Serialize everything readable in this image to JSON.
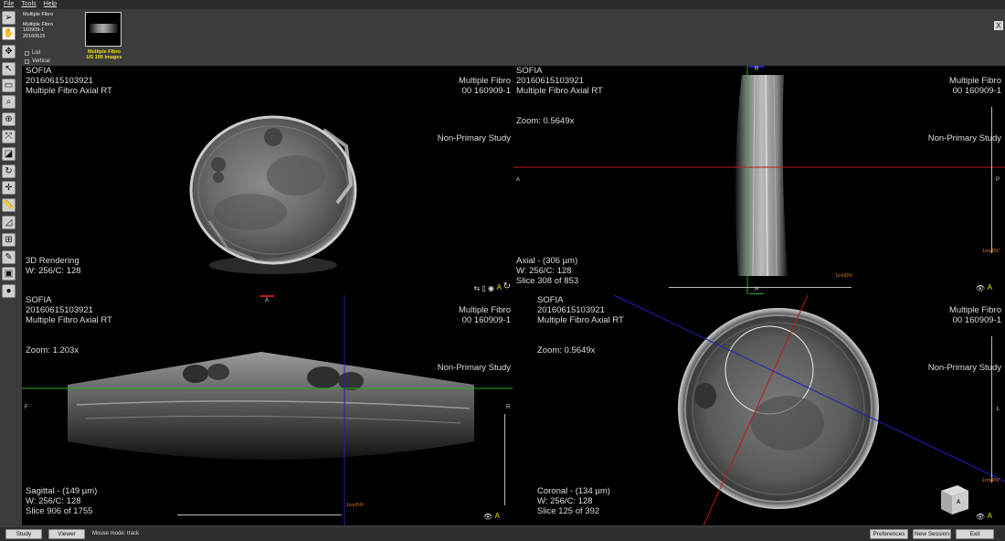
{
  "menu": {
    "file": "File",
    "tools": "Tools",
    "help": "Help"
  },
  "header": {
    "study_name": "Multiple Fibro",
    "patient_name": "Multiple Fibro",
    "patient_id": "160909-1",
    "study_date": "20160615",
    "thumb_label_1": "Multiple Fibro",
    "thumb_label_2": "US 195 images",
    "opt_list": "List",
    "opt_vertical": "Vertical",
    "close": "X"
  },
  "viewports": {
    "tl": {
      "inst": "SOFIA",
      "datetime": "20160615103921",
      "series": "Multiple Fibro Axial RT",
      "patient": "Multiple Fibro",
      "pid": "00   160909-1",
      "nonprimary": "Non-Primary Study",
      "mode": "3D Rendering",
      "wc": "W: 256/C: 128",
      "icons": "⇆ ▯ ◉",
      "orient": "A"
    },
    "tr": {
      "inst": "SOFIA",
      "datetime": "20160615103921",
      "series": "Multiple Fibro Axial RT",
      "patient": "Multiple Fibro",
      "pid": "00   160909-1",
      "zoom": "Zoom: 0.5649x",
      "nonprimary": "Non-Primary Study",
      "mode": "Axial - (306 µm)",
      "wc": "W: 256/C: 128",
      "slice": "Slice 308 of 853",
      "scale": "1cm/DIV",
      "orient": "A",
      "top": "R",
      "bottom": "H",
      "left": "A",
      "right": "P"
    },
    "bl": {
      "inst": "SOFIA",
      "datetime": "20160615103921",
      "series": "Multiple Fibro Axial RT",
      "patient": "Multiple Fibro",
      "pid": "00   160909-1",
      "zoom": "Zoom: 1.203x",
      "nonprimary": "Non-Primary Study",
      "mode": "Sagittal - (149 µm)",
      "wc": "W: 256/C: 128",
      "slice": "Slice 906 of 1755",
      "scale": "1cm/DIV",
      "orient": "A",
      "top": "A",
      "left": "F",
      "right": "R"
    },
    "br": {
      "inst": "SOFIA",
      "datetime": "20160615103921",
      "series": "Multiple Fibro Axial RT",
      "patient": "Multiple Fibro",
      "pid": "00   160909-1",
      "zoom": "Zoom: 0.5649x",
      "nonprimary": "Non-Primary Study",
      "mode": "Coronal - (134 µm)",
      "wc": "W: 256/C: 128",
      "slice": "Slice 125 of 392",
      "scale": "1cm/DIV",
      "orient": "A",
      "right": "L",
      "cube": "A"
    }
  },
  "status": {
    "study": "Study",
    "viewer": "Viewer",
    "mouse_mode": "Mouse mode: track",
    "preferences": "Preferences",
    "new_session": "New Session",
    "exit": "Exit"
  },
  "colors": {
    "crosshair_red": "#c01818",
    "crosshair_green": "#1fb01f",
    "crosshair_blue": "#2020c0",
    "scale_orange": "#e08020"
  }
}
